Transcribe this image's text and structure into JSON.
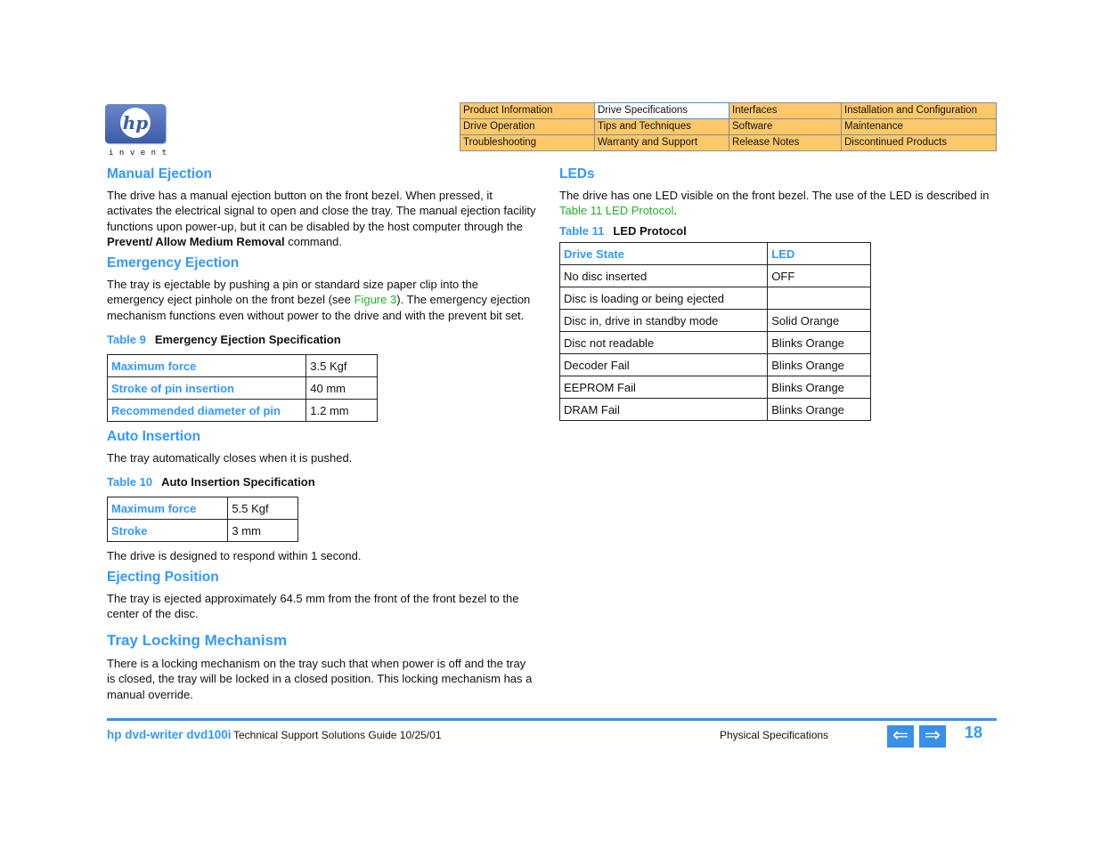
{
  "logo": {
    "mark": "hp",
    "tagline": "invent"
  },
  "nav": {
    "rows": [
      [
        "Product Information",
        "Drive Specifications",
        "Interfaces",
        "Installation and Configuration"
      ],
      [
        "Drive Operation",
        "Tips and Techniques",
        "Software",
        "Maintenance"
      ],
      [
        "Troubleshooting",
        "Warranty and Support",
        "Release Notes",
        "Discontinued Products"
      ]
    ],
    "active": "Drive Specifications",
    "colors": {
      "cell_bg": "#fcc86a",
      "active_border": "#4a90e2"
    }
  },
  "left": {
    "manual_ejection": {
      "heading": "Manual Ejection",
      "text_before": "The drive has a manual ejection button on the front bezel. When pressed, it activates the electrical signal to open and close the tray. The manual ejection facility functions upon power-up, but it can be disabled by the host computer through the ",
      "bold": "Prevent/ Allow Medium Removal",
      "text_after": " command."
    },
    "emergency_ejection": {
      "heading": "Emergency Ejection",
      "text_before": "The tray is ejectable by pushing a pin or standard size paper clip into the emergency eject pinhole on the front bezel (see ",
      "link": "Figure 3",
      "text_after": "). The emergency ejection mechanism functions even without power to the drive and with the prevent bit set."
    },
    "table9": {
      "number": "Table 9",
      "title": "Emergency Ejection Specification",
      "rows": [
        [
          "Maximum force",
          "3.5 Kgf"
        ],
        [
          "Stroke of pin insertion",
          "40 mm"
        ],
        [
          "Recommended diameter of pin",
          "1.2 mm"
        ]
      ]
    },
    "auto_insertion": {
      "heading": "Auto Insertion",
      "text": "The tray automatically closes when it is pushed."
    },
    "table10": {
      "number": "Table 10",
      "title": "Auto Insertion Specification",
      "rows": [
        [
          "Maximum force",
          "5.5 Kgf"
        ],
        [
          "Stroke",
          "3 mm"
        ]
      ],
      "note": "The drive is designed to respond within 1 second."
    },
    "ejecting_position": {
      "heading": "Ejecting Position",
      "text": "The tray is ejected approximately 64.5 mm from the front of the front bezel to the center of the disc."
    },
    "tray_locking": {
      "heading": "Tray Locking Mechanism",
      "text": "There is a locking mechanism on the tray such that when power is off and the tray is closed, the tray will be locked in a closed position. This locking mechanism has a manual override."
    }
  },
  "right": {
    "leds": {
      "heading": "LEDs",
      "text_before": "The drive has one LED visible on the front bezel. The use of the LED is described in ",
      "link": "Table 11  LED Protocol",
      "text_after": "."
    },
    "table11": {
      "number": "Table 11",
      "title": "LED Protocol",
      "headers": [
        "Drive State",
        "LED"
      ],
      "rows": [
        [
          "No disc inserted",
          "OFF"
        ],
        [
          "Disc is loading or being ejected",
          ""
        ],
        [
          "Disc in, drive in standby mode",
          "Solid Orange"
        ],
        [
          "Disc not readable",
          "Blinks Orange"
        ],
        [
          "Decoder Fail",
          "Blinks Orange"
        ],
        [
          "EEPROM Fail",
          "Blinks Orange"
        ],
        [
          "DRAM Fail",
          "Blinks Orange"
        ]
      ]
    }
  },
  "footer": {
    "brand": "hp dvd-writer  dvd100i",
    "guide": "Technical Support Solutions Guide 10/25/01",
    "section": "Physical Specifications",
    "prev_icon": "⇐",
    "next_icon": "⇒",
    "page": "18"
  },
  "colors": {
    "heading": "#3399ff",
    "link": "#22b322",
    "rule": "#3a8fe8"
  }
}
